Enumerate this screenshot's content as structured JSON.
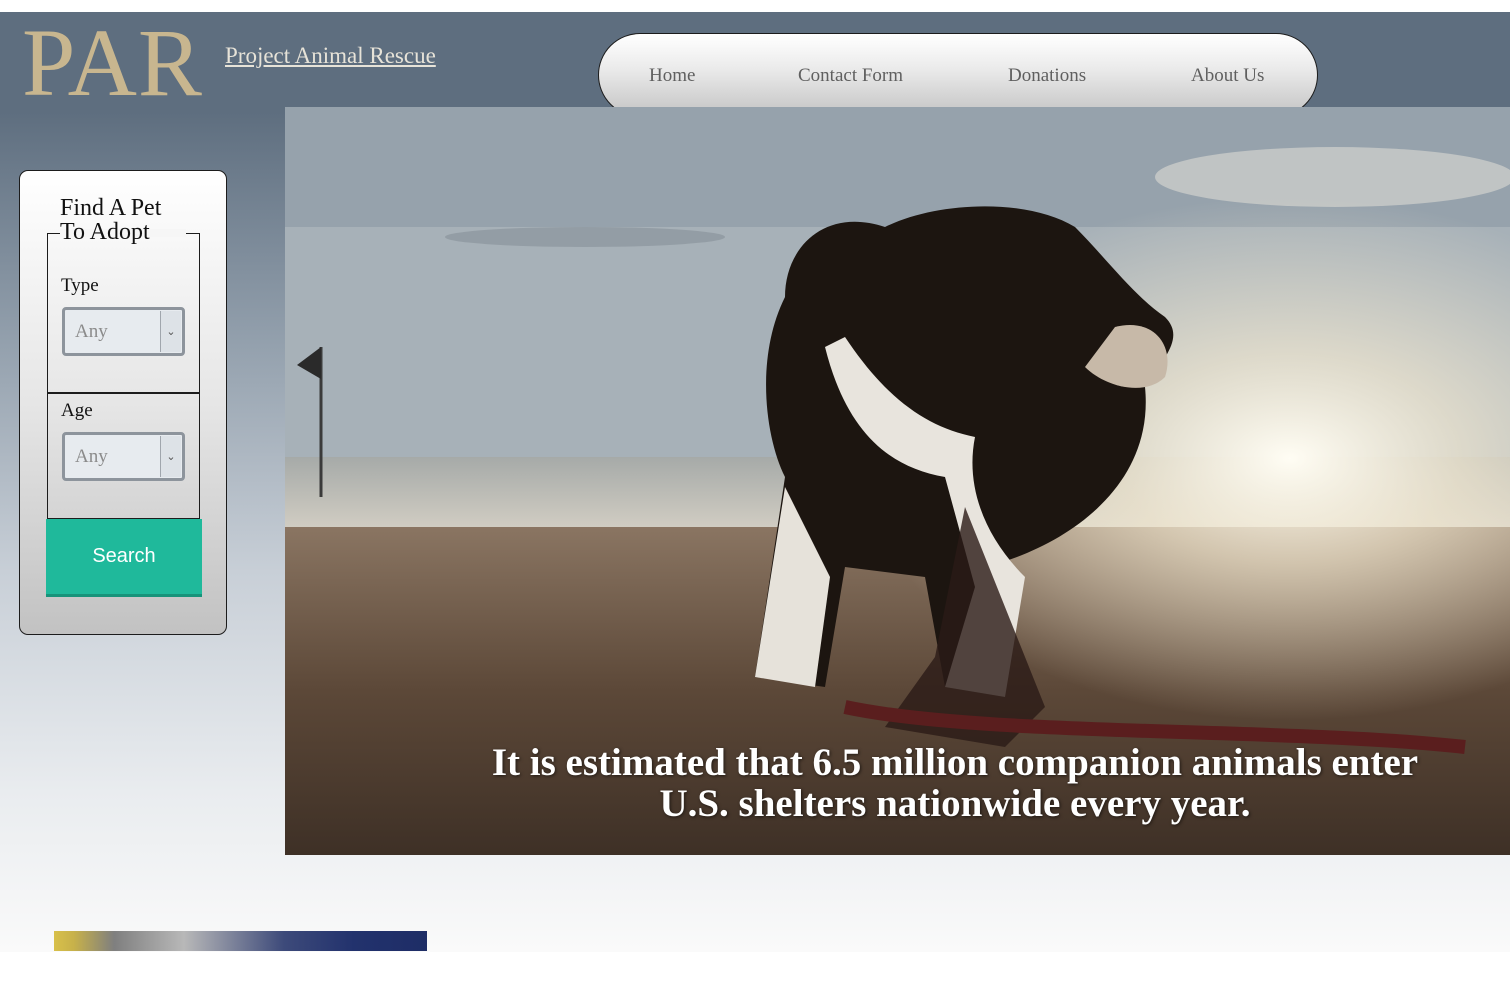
{
  "header": {
    "logo": "PAR",
    "site_name": "Project Animal Rescue"
  },
  "nav": {
    "items": [
      {
        "label": "Home"
      },
      {
        "label": "Contact Form"
      },
      {
        "label": "Donations"
      },
      {
        "label": "About Us"
      }
    ]
  },
  "search_panel": {
    "title": "Find A Pet To Adopt",
    "type_label": "Type",
    "type_value": "Any",
    "age_label": "Age",
    "age_value": "Any",
    "search_label": "Search"
  },
  "hero": {
    "caption": "It is estimated that 6.5 million companion animals enter U.S. shelters nationwide every year."
  },
  "colors": {
    "logo": "#c8b68f",
    "header_bg": "#5e6e7f",
    "search_button": "#1fb99b"
  },
  "icons": [
    "chevron-down-icon"
  ]
}
